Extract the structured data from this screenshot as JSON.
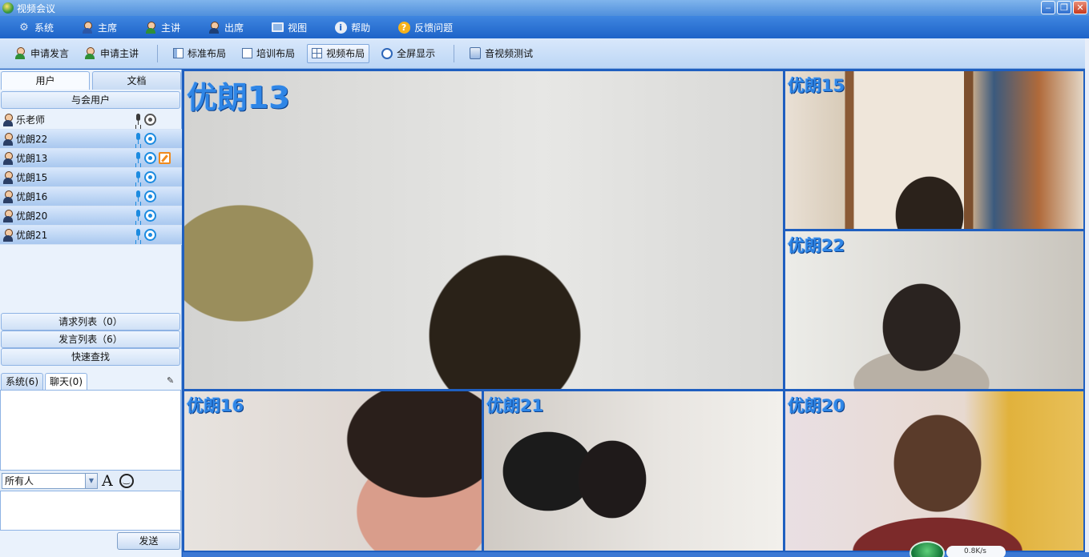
{
  "window": {
    "title": "视频会议",
    "minimize": "‒",
    "restore": "❐",
    "close": "✕"
  },
  "menu": [
    {
      "label": "系统",
      "icon": "gear-icon"
    },
    {
      "label": "主席",
      "icon": "chairman-icon"
    },
    {
      "label": "主讲",
      "icon": "speaker-icon"
    },
    {
      "label": "出席",
      "icon": "attendee-icon"
    },
    {
      "label": "视图",
      "icon": "monitor-icon"
    },
    {
      "label": "帮助",
      "icon": "info-icon"
    },
    {
      "label": "反馈问题",
      "icon": "help-icon"
    }
  ],
  "toolbar": {
    "request_speak": "申请发言",
    "request_host": "申请主讲",
    "standard_layout": "标准布局",
    "training_layout": "培训布局",
    "video_layout": "视频布局",
    "fullscreen": "全屏显示",
    "av_test": "音视频测试",
    "active": "video_layout"
  },
  "left_panel": {
    "tabs": [
      "用户",
      "文档"
    ],
    "active_tab": "用户",
    "attendees_header": "与会用户",
    "users": [
      {
        "name": "乐老师",
        "online": false,
        "mic": false,
        "cam": false,
        "editing": false
      },
      {
        "name": "优朗22",
        "online": true,
        "mic": true,
        "cam": true,
        "editing": false
      },
      {
        "name": "优朗13",
        "online": true,
        "mic": true,
        "cam": true,
        "editing": true
      },
      {
        "name": "优朗15",
        "online": true,
        "mic": true,
        "cam": true,
        "editing": false
      },
      {
        "name": "优朗16",
        "online": true,
        "mic": true,
        "cam": true,
        "editing": false
      },
      {
        "name": "优朗20",
        "online": true,
        "mic": true,
        "cam": true,
        "editing": false
      },
      {
        "name": "优朗21",
        "online": true,
        "mic": true,
        "cam": true,
        "editing": false
      }
    ],
    "request_list": "请求列表（0）",
    "speak_list": "发言列表（6）",
    "quick_search": "快速查找",
    "chat_tabs": [
      "系统(6)",
      "聊天(0)"
    ],
    "active_chat_tab": "聊天(0)",
    "recipient": "所有人",
    "font_glyph": "A",
    "send": "发送"
  },
  "videos": {
    "main": "优朗13",
    "top_right": "优朗15",
    "mid_right": "优朗22",
    "bottom_left": "优朗16",
    "bottom_mid": "优朗21",
    "bottom_right": "优朗20"
  },
  "network": {
    "speed": "0.8K/s"
  },
  "colors": {
    "accent": "#1d63c8",
    "label_blue": "#2f86e6",
    "active_icon": "#1c8be0",
    "edit_orange": "#f08a1c"
  }
}
